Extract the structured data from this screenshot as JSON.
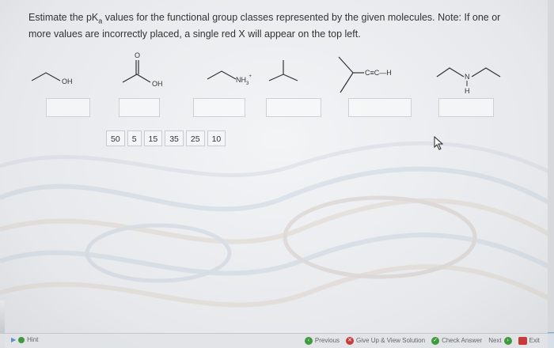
{
  "instructions": {
    "line1": "Estimate the pK",
    "sub": "a",
    "line1b": " values for the functional group classes represented by the given molecules. Note: If one or",
    "line2": "more values are incorrectly placed, a single red X will appear on the top left."
  },
  "molecules": {
    "m1_label": "OH",
    "m2_o": "O",
    "m2_label": "OH",
    "m3_label": "NH",
    "m3_sub": "3",
    "m3_sup": "+",
    "m5_label": "C≡C—H",
    "m6_n": "N",
    "m6_h": "H"
  },
  "choices": [
    "50",
    "5",
    "15",
    "35",
    "25",
    "10"
  ],
  "footer": {
    "hint": "Hint",
    "previous": "Previous",
    "give_up": "Give Up & View Solution",
    "check": "Check Answer",
    "next": "Next",
    "exit": "Exit"
  }
}
